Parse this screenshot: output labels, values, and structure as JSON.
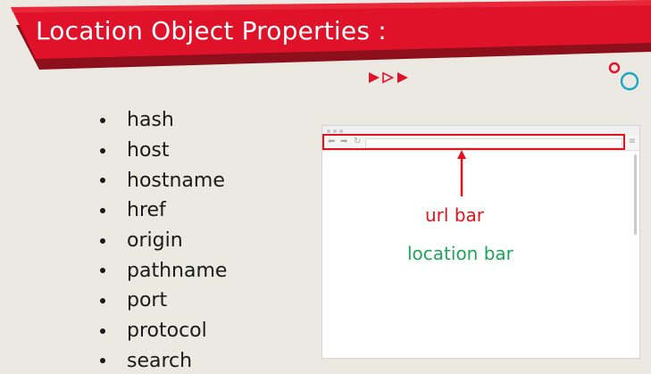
{
  "header": {
    "title": "Location Object Properties :",
    "deco_arrows": "triple-play-arrows-icon",
    "deco_circles": "linked-circles-icon"
  },
  "properties": [
    "hash",
    "host",
    "hostname",
    "href",
    "origin",
    "pathname",
    "port",
    "protocol",
    "search"
  ],
  "illustration": {
    "browser_icons": [
      "back-icon",
      "forward-icon",
      "reload-icon",
      "menu-icon"
    ],
    "url_bar_label": "url bar",
    "location_bar_label": "location bar"
  },
  "colors": {
    "banner_red": "#e0122a",
    "banner_shadow": "#8e0f1c",
    "accent_teal": "#1aa6c8",
    "url_bar_red": "#e0121b",
    "location_green": "#1fa25a",
    "background": "#ece9e3"
  }
}
